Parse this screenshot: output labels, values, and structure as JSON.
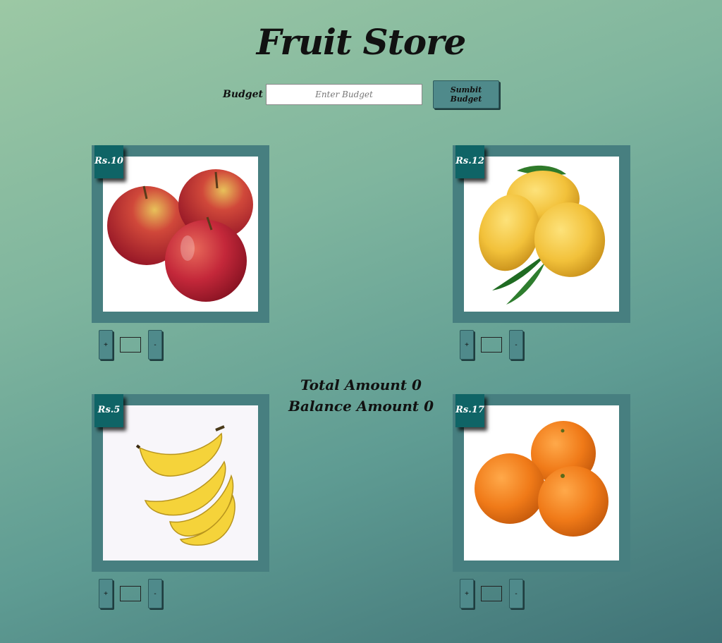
{
  "header": {
    "title": "Fruit Store"
  },
  "budget": {
    "label": "Budget",
    "placeholder": "Enter Budget",
    "value": "",
    "submit_label": "Sumbit Budget"
  },
  "products": [
    {
      "name": "apple",
      "price_label": "Rs.10",
      "quantity": "",
      "plus_label": "+",
      "minus_label": "-"
    },
    {
      "name": "mango",
      "price_label": "Rs.12",
      "quantity": "",
      "plus_label": "+",
      "minus_label": "-"
    },
    {
      "name": "banana",
      "price_label": "Rs.5",
      "quantity": "",
      "plus_label": "+",
      "minus_label": "-"
    },
    {
      "name": "orange",
      "price_label": "Rs.17",
      "quantity": "",
      "plus_label": "+",
      "minus_label": "-"
    }
  ],
  "totals": {
    "total_label": "Total Amount 0",
    "balance_label": "Balance Amount 0"
  },
  "colors": {
    "card_border": "#477f80",
    "price_tag": "#0f6466",
    "button": "#4f8a8b"
  }
}
